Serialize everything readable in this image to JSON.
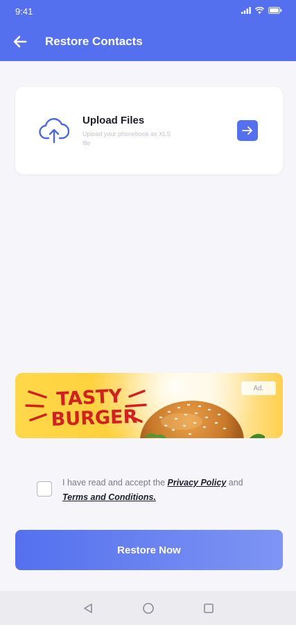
{
  "status_bar": {
    "time": "9:41"
  },
  "header": {
    "title": "Restore Contacts",
    "icon": "back-arrow-icon",
    "color": "#5470ee"
  },
  "upload_card": {
    "title": "Upload Files",
    "subtitle": "Upload your phonebook as XLS file",
    "icon": "cloud-upload-icon",
    "action_icon": "arrow-right-icon"
  },
  "ad": {
    "line1": "TASTY",
    "line2": "BURGER",
    "tag": "Ad."
  },
  "consent": {
    "checked": false,
    "prefix": "I have read and accept the ",
    "privacy_label": "Privacy Policy",
    "middle": " and ",
    "terms_label": "Terms and Conditions."
  },
  "restore_button": {
    "label": "Restore Now"
  },
  "nav": {
    "back": "back-triangle-icon",
    "home": "home-circle-icon",
    "recents": "recents-square-icon"
  }
}
